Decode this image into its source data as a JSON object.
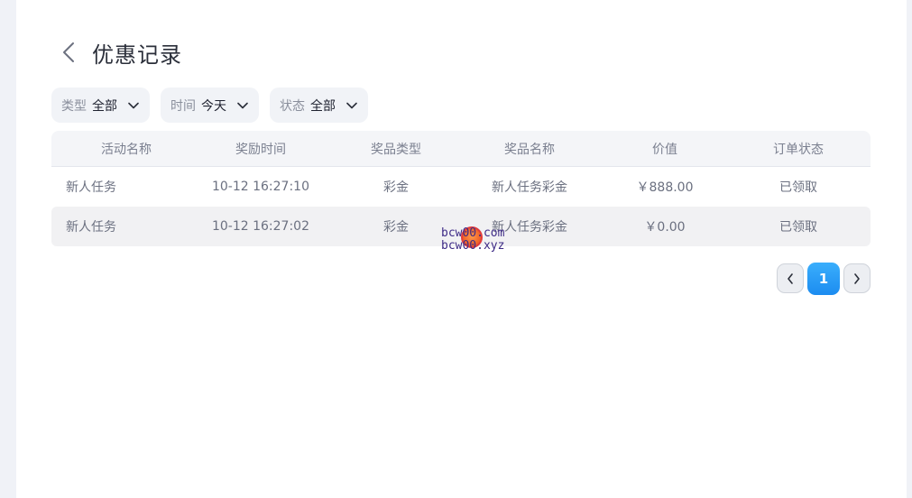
{
  "header": {
    "title": "优惠记录"
  },
  "filters": [
    {
      "label": "类型",
      "value": "全部"
    },
    {
      "label": "时间",
      "value": "今天"
    },
    {
      "label": "状态",
      "value": "全部"
    }
  ],
  "table": {
    "columns": [
      "活动名称",
      "奖励时间",
      "奖品类型",
      "奖品名称",
      "价值",
      "订单状态"
    ],
    "rows": [
      [
        "新人任务",
        "10-12 16:27:10",
        "彩金",
        "新人任务彩金",
        "￥888.00",
        "已领取"
      ],
      [
        "新人任务",
        "10-12 16:27:02",
        "彩金",
        "新人任务彩金",
        "￥0.00",
        "已领取"
      ]
    ]
  },
  "pagination": {
    "current": "1"
  },
  "watermark": {
    "line1": "bcw00.com",
    "line2": "bcw00.xyz"
  },
  "colors": {
    "accent": "#1c8cf0",
    "background": "#f0f2f7",
    "panel": "#ffffff"
  },
  "icons": {
    "back": "chevron-left-icon",
    "dropdown": "chevron-down-icon",
    "prev": "chevron-left-icon",
    "next": "chevron-right-icon"
  }
}
